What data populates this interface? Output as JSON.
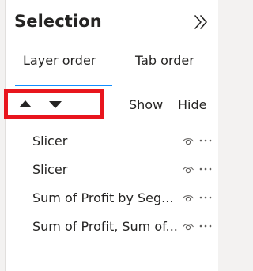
{
  "pane": {
    "title": "Selection",
    "collapse_icon": "double-chevron-right-icon"
  },
  "tabs": [
    {
      "label": "Layer order",
      "active": true
    },
    {
      "label": "Tab order",
      "active": false
    }
  ],
  "toolbar": {
    "move_up_icon": "triangle-up-icon",
    "move_down_icon": "triangle-down-icon",
    "show_label": "Show",
    "hide_label": "Hide",
    "highlight_color": "#e8151d"
  },
  "layers": [
    {
      "name": "Slicer",
      "visibility_icon": "eye-icon",
      "menu_icon": "more-icon"
    },
    {
      "name": "Slicer",
      "visibility_icon": "eye-icon",
      "menu_icon": "more-icon"
    },
    {
      "name": "Sum of Profit by Seg...",
      "visibility_icon": "eye-icon",
      "menu_icon": "more-icon"
    },
    {
      "name": "Sum of Profit, Sum of...",
      "visibility_icon": "eye-icon",
      "menu_icon": "more-icon"
    }
  ],
  "colors": {
    "accent": "#118dff",
    "text": "#252423",
    "background": "#ffffff"
  }
}
